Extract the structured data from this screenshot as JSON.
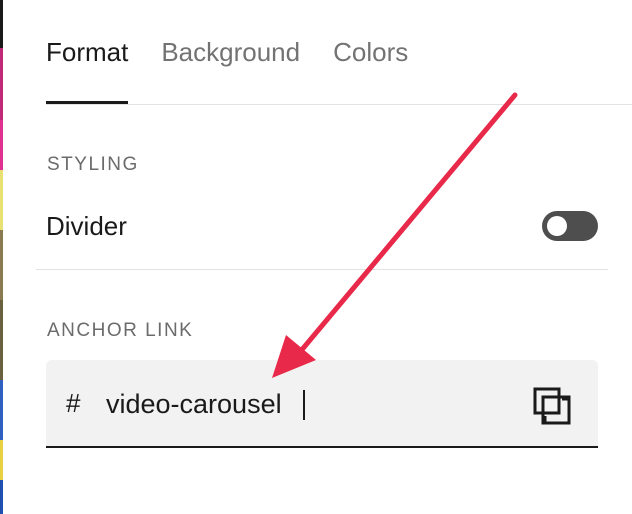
{
  "tabs": [
    {
      "label": "Format",
      "active": true
    },
    {
      "label": "Background",
      "active": false
    },
    {
      "label": "Colors",
      "active": false
    }
  ],
  "styling": {
    "heading": "STYLING",
    "divider_label": "Divider",
    "divider_enabled": false
  },
  "anchor": {
    "heading": "ANCHOR LINK",
    "prefix": "#",
    "value": "video-carousel",
    "copy_icon": "copy-icon"
  },
  "annotation": {
    "arrow_color": "#e8294a"
  },
  "colors": {
    "active_text": "#1a1a1a",
    "inactive_tab": "#737373",
    "toggle_off": "#4e4e4e",
    "field_bg": "#f2f2f2"
  }
}
